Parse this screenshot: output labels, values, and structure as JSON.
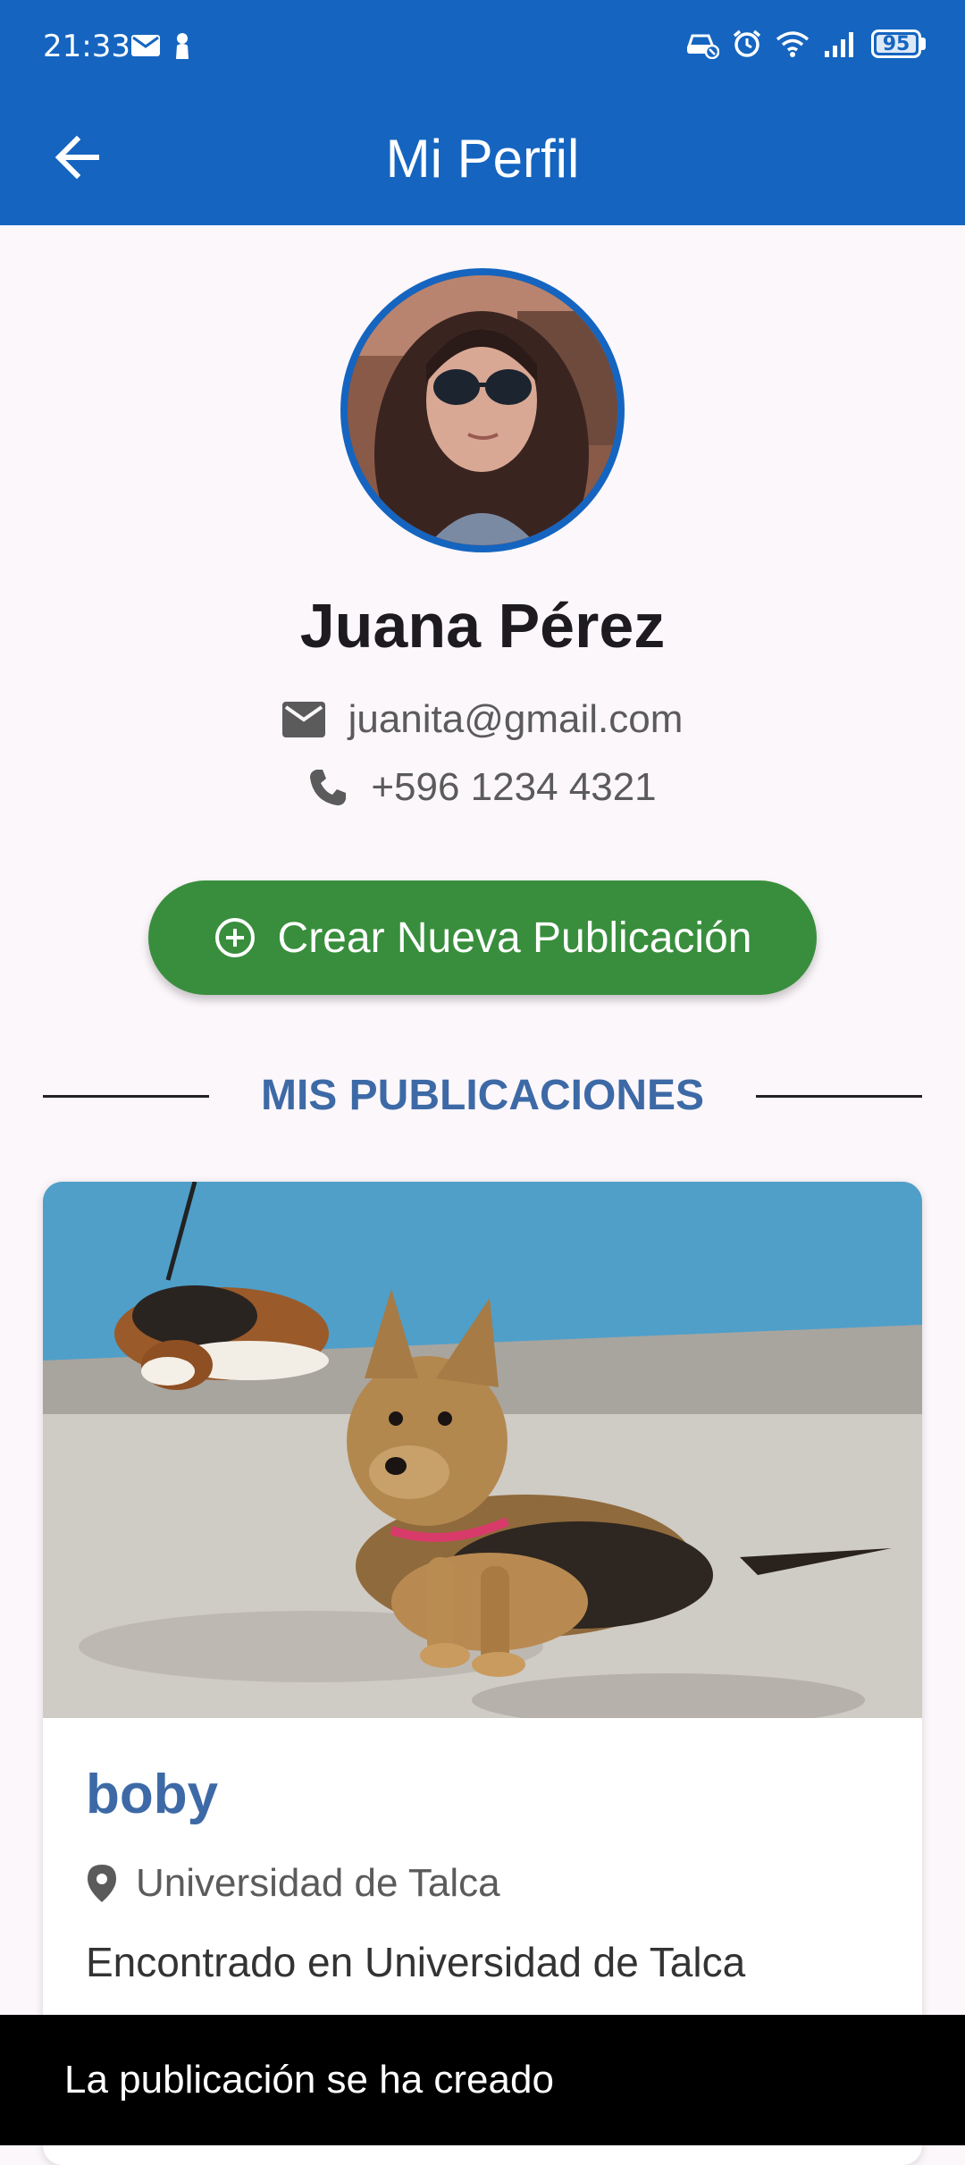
{
  "status_bar": {
    "time": "21:33",
    "battery": "95",
    "icons": [
      "mail-icon",
      "person-icon",
      "car-mode-icon",
      "alarm-icon",
      "wifi-icon",
      "signal-icon",
      "battery-icon"
    ]
  },
  "app_bar": {
    "title": "Mi Perfil",
    "back_icon": "arrow-back-icon"
  },
  "profile": {
    "name": "Juana Pérez",
    "email": "juanita@gmail.com",
    "phone": "+596 1234 4321"
  },
  "create_button": {
    "label": "Crear Nueva Publicación",
    "icon": "add-circle-icon"
  },
  "section": {
    "title": "MIS PUBLICACIONES"
  },
  "posts": [
    {
      "title": "boby",
      "location": "Universidad de Talca",
      "description": "Encontrado en Universidad de Talca"
    }
  ],
  "snackbar": {
    "message": "La publicación se ha creado"
  },
  "colors": {
    "primary": "#1565c0",
    "accent_green": "#388e3c",
    "section_blue": "#3d6aa6",
    "background": "#fcf7fb"
  }
}
